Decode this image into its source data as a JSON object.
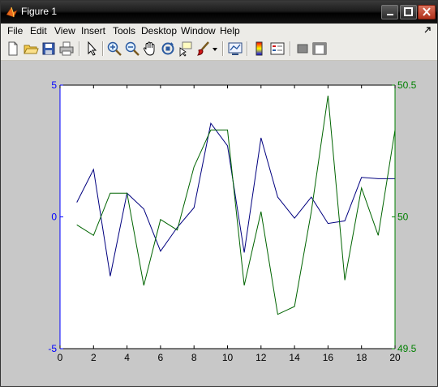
{
  "window": {
    "title": "Figure 1"
  },
  "menu": {
    "items": [
      "File",
      "Edit",
      "View",
      "Insert",
      "Tools",
      "Desktop",
      "Window",
      "Help"
    ],
    "overflow_icon": "arrow-icon"
  },
  "toolbar": {
    "icons": [
      "new-figure-icon",
      "open-file-icon",
      "save-icon",
      "print-icon",
      "edit-plot-arrow-icon",
      "zoom-in-icon",
      "zoom-out-icon",
      "pan-hand-icon",
      "rotate-3d-icon",
      "data-cursor-icon",
      "brush-icon",
      "brush-dropdown-icon",
      "link-plot-icon",
      "colorbar-icon",
      "legend-icon",
      "hide-plot-tools-icon",
      "show-plot-tools-icon"
    ]
  },
  "colors": {
    "left_axis": "#0000ff",
    "right_axis": "#008000",
    "series1": "#00007f",
    "series2": "#006400"
  },
  "chart_data": {
    "type": "line",
    "x": [
      1,
      2,
      3,
      4,
      5,
      6,
      7,
      8,
      9,
      10,
      11,
      12,
      13,
      14,
      15,
      16,
      17,
      18,
      19,
      20
    ],
    "xlim": [
      0,
      20
    ],
    "xticks": [
      "0",
      "2",
      "4",
      "6",
      "8",
      "10",
      "12",
      "14",
      "16",
      "18",
      "20"
    ],
    "left_axis": {
      "ylim": [
        -5,
        5
      ],
      "yticks": [
        "-5",
        "0",
        "5"
      ]
    },
    "right_axis": {
      "ylim": [
        49.5,
        50.5
      ],
      "yticks": [
        "49.5",
        "50",
        "50.5"
      ]
    },
    "grid": false,
    "series": [
      {
        "axis": "left",
        "values": [
          0.55,
          1.8,
          -2.25,
          0.9,
          0.3,
          -1.3,
          -0.4,
          0.35,
          3.55,
          2.7,
          -1.35,
          3.0,
          0.75,
          -0.05,
          0.75,
          -0.25,
          -0.15,
          1.5,
          1.45,
          1.45
        ]
      },
      {
        "axis": "right",
        "values": [
          49.97,
          49.93,
          50.09,
          50.09,
          49.74,
          49.99,
          49.95,
          50.19,
          50.33,
          50.33,
          49.74,
          50.02,
          49.63,
          49.66,
          50.02,
          50.46,
          49.76,
          50.11,
          49.93,
          50.33
        ]
      }
    ]
  }
}
